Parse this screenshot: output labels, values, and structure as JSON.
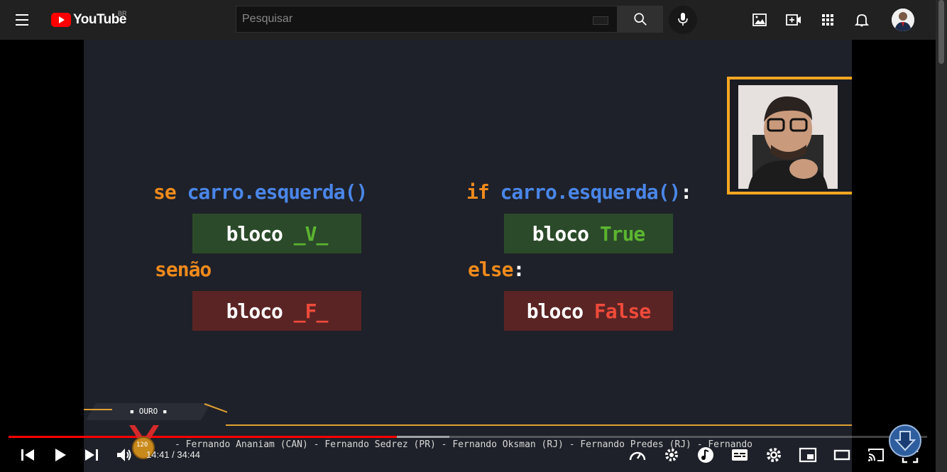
{
  "masthead": {
    "logo_text": "YouTube",
    "country_code": "BR",
    "search_placeholder": "Pesquisar"
  },
  "video": {
    "left_code": {
      "if_keyword": "se",
      "condition": "carro.esquerda()",
      "true_block_word": "bloco",
      "true_block_value": "_V_",
      "else_keyword": "senão",
      "false_block_word": "bloco",
      "false_block_value": "_F_"
    },
    "right_code": {
      "if_keyword": "if",
      "condition": "carro.esquerda()",
      "colon": ":",
      "true_block_word": "bloco",
      "true_block_value": "True",
      "else_keyword": "else",
      "else_colon": ":",
      "false_block_word": "bloco",
      "false_block_value": "False"
    },
    "badge": "▪ OURO ▪",
    "medal_number": "120",
    "ticker_text": "- Fernando Ananiam (CAN) - Fernando Sedrez (PR) - Fernando Oksman (RJ) - Fernando Predes (RJ) - Fernando"
  },
  "player": {
    "current_time": "14:41",
    "separator": " / ",
    "duration": "34:44",
    "progress_played": 0.423,
    "progress_buffered": 0.48
  },
  "colors": {
    "keyword": "#f08a1c",
    "function": "#4a86e8",
    "true_green": "#5cb531",
    "false_red": "#ef4a3a",
    "accent_red": "#ff0000"
  }
}
